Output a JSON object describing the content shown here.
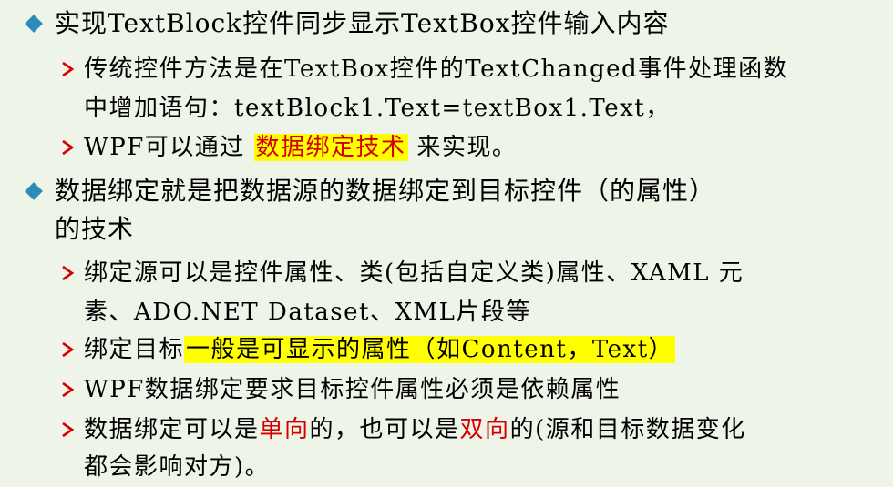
{
  "colors": {
    "background": "#eef4e8",
    "diamond_bullet": "#2b8cb8",
    "arrow_bullet": "#d40000",
    "highlight": "#ffff00",
    "emphasis_red": "#d40000"
  },
  "icons": {
    "level1_bullet": "diamond-bullet-icon",
    "level2_bullet": "arrow-bullet-icon"
  },
  "item1": {
    "text": "实现TextBlock控件同步显示TextBox控件输入内容",
    "sub1": {
      "line1": "传统控件方法是在TextBox控件的TextChanged事件处理函数",
      "line2": "中增加语句：textBlock1.Text=textBox1.Text，"
    },
    "sub2": {
      "before": "WPF可以通过",
      "highlight": "数据绑定技术",
      "after": "来实现。"
    }
  },
  "item2": {
    "line1": "数据绑定就是把数据源的数据绑定到目标控件（的属性）",
    "line2": "的技术",
    "sub1": {
      "line1": "绑定源可以是控件属性、类(包括自定义类)属性、XAML 元",
      "line2": "素、ADO.NET Dataset、XML片段等"
    },
    "sub2": {
      "before": "绑定目标",
      "highlight": "一般是可显示的属性（如Content，Text）"
    },
    "sub3": {
      "text": "WPF数据绑定要求目标控件属性必须是依赖属性"
    },
    "sub4": {
      "part1": "数据绑定可以是",
      "red1": "单向",
      "part2": "的，也可以是",
      "red2": "双向",
      "part3": "的(源和目标数据变化",
      "line2": "都会影响对方)。"
    }
  }
}
